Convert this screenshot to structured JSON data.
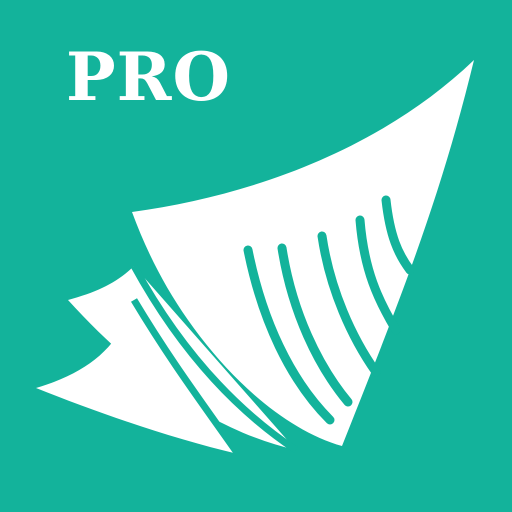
{
  "badge": {
    "label": "PRO"
  },
  "logo": {
    "icon": "fanned-pages-icon"
  },
  "colors": {
    "background": "#13b39b",
    "foreground": "#ffffff"
  }
}
